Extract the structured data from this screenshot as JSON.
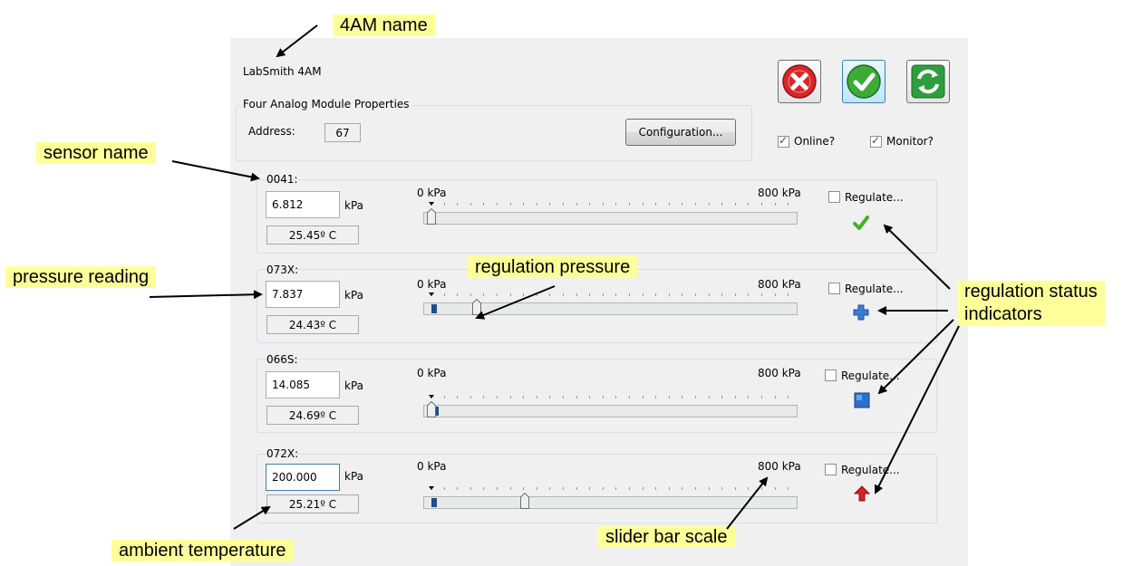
{
  "window": {
    "title": "LabSmith 4AM",
    "group_label": "Four Analog Module Properties",
    "address_label": "Address:",
    "address_value": "67",
    "config_button": "Configuration...",
    "online_label": "Online?",
    "online_checked": true,
    "monitor_label": "Monitor?",
    "monitor_checked": true,
    "buttons": {
      "cancel_icon": "red-x-icon",
      "ok_icon": "green-check-icon",
      "refresh_icon": "green-refresh-icon"
    }
  },
  "sensors": [
    {
      "name": "0041:",
      "pressure": "6.812",
      "unit": "kPa",
      "temperature": "25.45º C",
      "scale_min": "0 kPa",
      "scale_max": "800 kPa",
      "regulate_label": "Regulate...",
      "regulate_checked": false,
      "regulation_pressure_fraction": 0.0,
      "pressure_fill_fraction": 0.0,
      "status_icon": "green-check-icon"
    },
    {
      "name": "073X:",
      "pressure": "7.837",
      "unit": "kPa",
      "temperature": "24.43º C",
      "scale_min": "0 kPa",
      "scale_max": "800 kPa",
      "regulate_label": "Regulate...",
      "regulate_checked": false,
      "regulation_pressure_fraction": 0.12,
      "pressure_fill_fraction": 0.03,
      "status_icon": "blue-plus-icon"
    },
    {
      "name": "066S:",
      "pressure": "14.085",
      "unit": "kPa",
      "temperature": "24.69º C",
      "scale_min": "0 kPa",
      "scale_max": "800 kPa",
      "regulate_label": "Regulate...",
      "regulate_checked": false,
      "regulation_pressure_fraction": 0.0,
      "pressure_fill_fraction": 0.04,
      "status_icon": "blue-square-icon"
    },
    {
      "name": "072X:",
      "pressure": "200.000",
      "unit": "kPa",
      "temperature": "25.21º C",
      "scale_min": "0 kPa",
      "scale_max": "800 kPa",
      "regulate_label": "Regulate...",
      "regulate_checked": false,
      "regulation_pressure_fraction": 0.25,
      "pressure_fill_fraction": 0.03,
      "status_icon": "red-up-arrow-icon"
    }
  ],
  "annotations": {
    "name_4am": "4AM name",
    "sensor_name": "sensor name",
    "pressure_reading": "pressure reading",
    "regulation_pressure": "regulation pressure",
    "regulation_status_line1": "regulation status",
    "regulation_status_line2": "indicators",
    "ambient_temperature": "ambient temperature",
    "slider_bar_scale": "slider bar scale"
  },
  "colors": {
    "annotation_bg": "#ffff99",
    "dialog_bg": "#f0f0f0",
    "slider_fill": "#1f4e8c"
  }
}
